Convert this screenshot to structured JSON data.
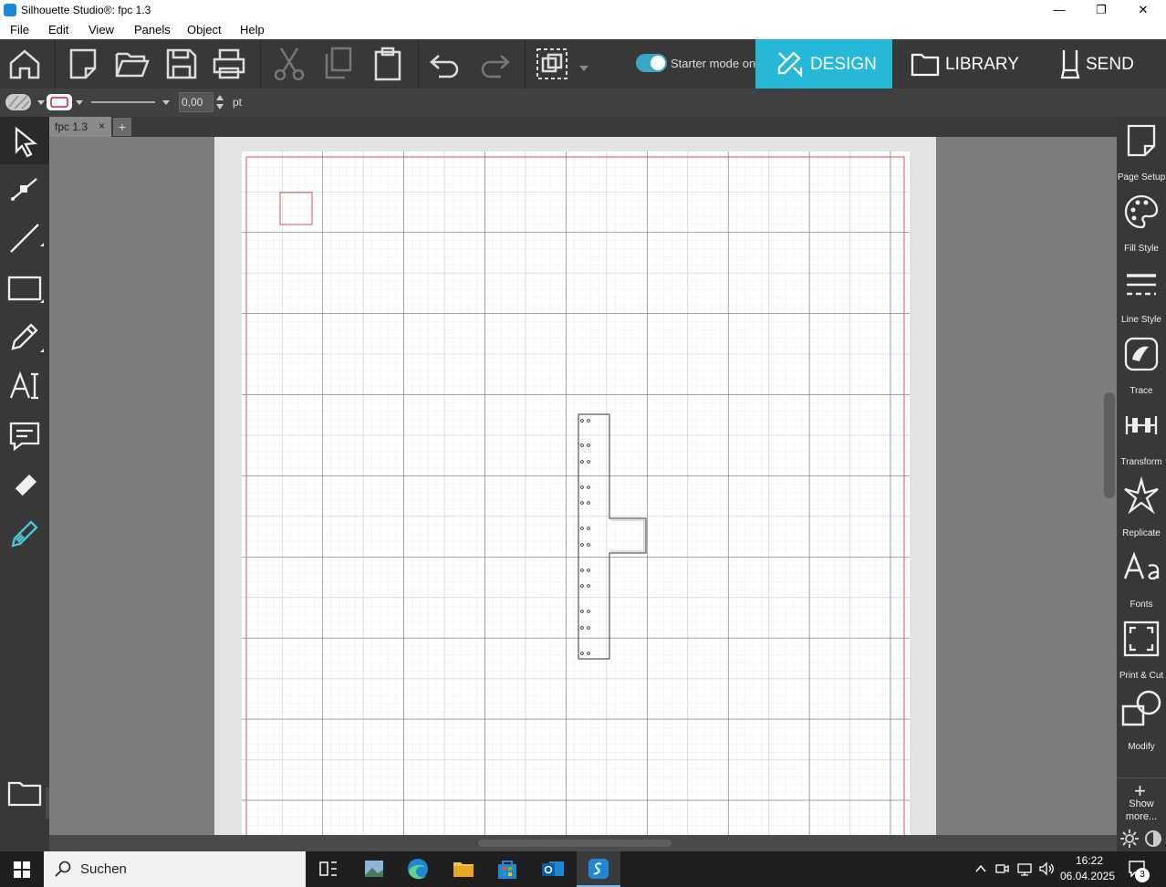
{
  "window": {
    "title": "Silhouette Studio®: fpc 1.3",
    "minimize": "—",
    "maximize": "❐",
    "close": "✕"
  },
  "menu": {
    "items": [
      "File",
      "Edit",
      "View",
      "Panels",
      "Object",
      "Help"
    ]
  },
  "toolbar": {
    "starter_mode_label": "Starter mode on",
    "starter_mode_on": true,
    "tabs": {
      "design": "DESIGN",
      "library": "LIBRARY",
      "send": "SEND"
    },
    "accent": "#26b8d8"
  },
  "properties": {
    "line_width": "0,00",
    "unit": "pt"
  },
  "document": {
    "tab_name": "fpc 1.3",
    "tab_close": "×",
    "add_tab": "+"
  },
  "right_panel": {
    "items": [
      "Page Setup",
      "Fill Style",
      "Line Style",
      "Trace",
      "Transform",
      "Replicate",
      "Fonts",
      "Print & Cut",
      "Modify"
    ],
    "show_more": "Show more..."
  },
  "taskbar": {
    "search_placeholder": "Suchen",
    "time": "16:22",
    "date": "06.04.2025",
    "notifications": "3"
  }
}
